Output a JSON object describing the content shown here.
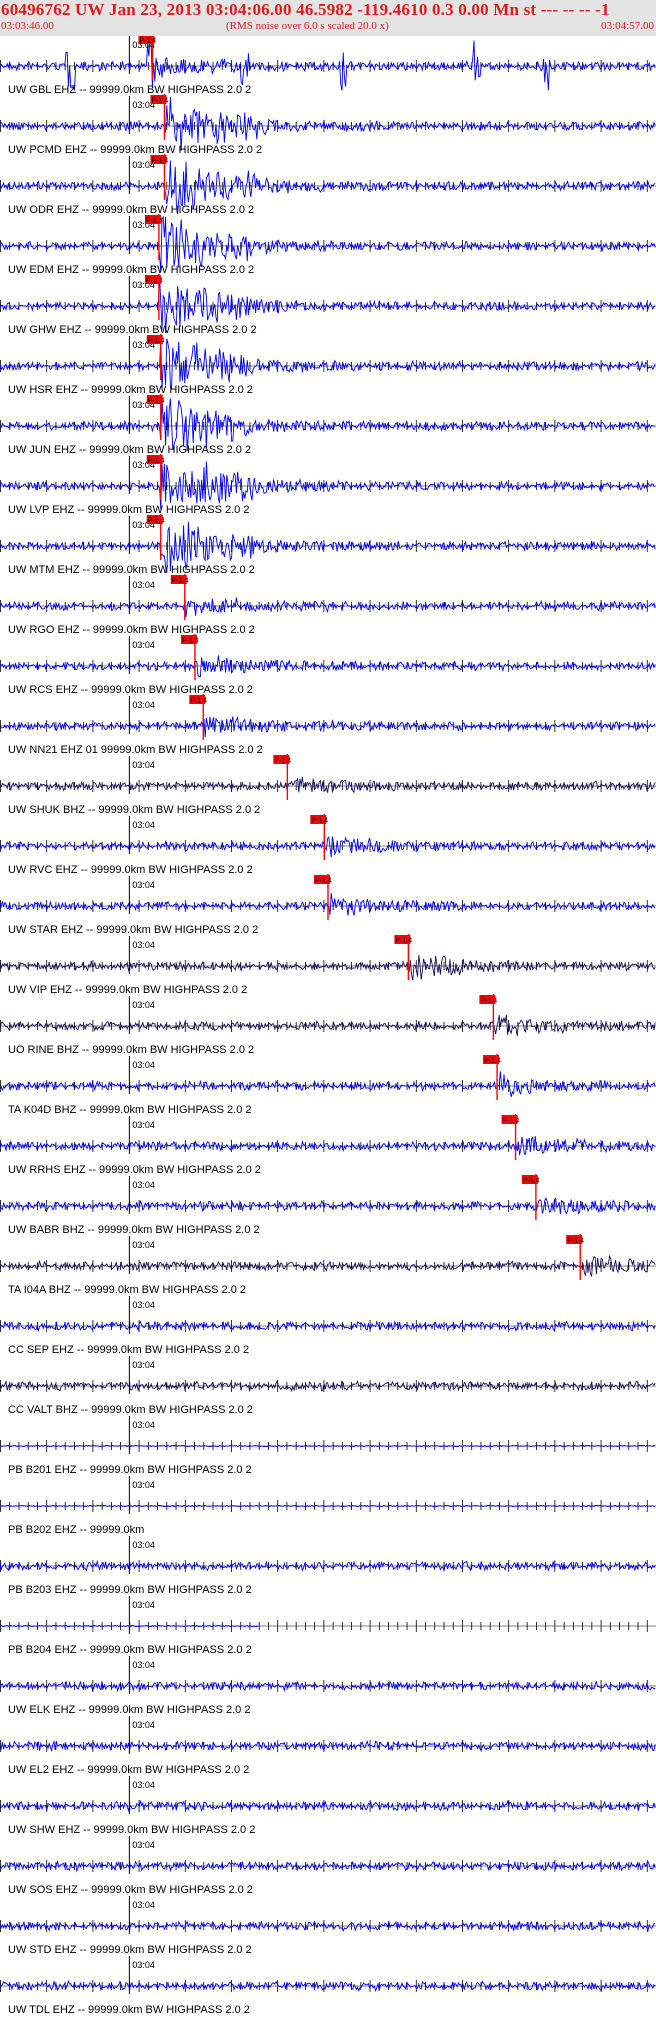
{
  "header": {
    "title": "60496762 UW Jan 23, 2013 03:04:06.00   46.5982 -119.4610  0.3 0.00 Mn st --- -- --  -1",
    "start_time": "03:03:46.00",
    "note": "(RMS noise over 6.0 s scaled 20.0 x)",
    "end_time": "03:04:57.00"
  },
  "chart_data": {
    "type": "line",
    "title": "60496762 UW Jan 23, 2013 03:04:06.00   46.5982 -119.4610  0.3 0.00 Mn st --- -- --  -1",
    "x_range": [
      "03:03:46.00",
      "03:04:57.00"
    ],
    "minute_tick_label": "03:04",
    "pick_label": "P-1.4",
    "grid": false,
    "colors": {
      "trace_blue": "#0000ff",
      "trace_dark": "#1a0a5e",
      "pick_red": "#ff0000",
      "tick": "#000000"
    },
    "series": [
      {
        "name": "UW GBL EHZ -- 99999.0km BW  HIGHPASS  2.0  2",
        "pick_s": 16.5,
        "label_pos": "bottom"
      },
      {
        "name": "UW PCMD EHZ -- 99999.0km BW  HIGHPASS  2.0  2",
        "pick_s": 17.8,
        "label_pos": "bottom"
      },
      {
        "name": "UW ODR EHZ -- 99999.0km BW  HIGHPASS  2.0  2",
        "pick_s": 17.8,
        "label_pos": "bottom"
      },
      {
        "name": "UW EDM EHZ -- 99999.0km BW  HIGHPASS  2.0  2",
        "pick_s": 17.2,
        "label_pos": "bottom"
      },
      {
        "name": "UW GHW EHZ -- 99999.0km BW  HIGHPASS  2.0  2",
        "pick_s": 17.2,
        "label_pos": "bottom"
      },
      {
        "name": "UW HSR EHZ -- 99999.0km BW  HIGHPASS  2.0  2",
        "pick_s": 17.4,
        "label_pos": "bottom"
      },
      {
        "name": "UW JUN EHZ -- 99999.0km BW  HIGHPASS  2.0  2",
        "pick_s": 17.4,
        "label_pos": "bottom"
      },
      {
        "name": "UW LVP EHZ -- 99999.0km BW  HIGHPASS  2.0  2",
        "pick_s": 17.4,
        "label_pos": "bottom"
      },
      {
        "name": "UW MTM EHZ -- 99999.0km BW  HIGHPASS  2.0  2",
        "pick_s": 17.4,
        "label_pos": "bottom"
      },
      {
        "name": "UW RGO EHZ -- 99999.0km BW  HIGHPASS  2.0  2",
        "pick_s": 20.0,
        "label_pos": "bottom"
      },
      {
        "name": "UW RCS EHZ -- 99999.0km BW  HIGHPASS  2.0  2",
        "pick_s": 21.1,
        "label_pos": "bottom"
      },
      {
        "name": "UW NN21 EHZ 01 99999.0km BW  HIGHPASS  2.0  2",
        "pick_s": 22.0,
        "label_pos": "bottom"
      },
      {
        "name": "UW SHUK BHZ -- 99999.0km BW  HIGHPASS  2.0  2",
        "pick_s": 31.1,
        "label_pos": "bottom"
      },
      {
        "name": "UW RVC EHZ -- 99999.0km BW  HIGHPASS  2.0  2",
        "pick_s": 35.1,
        "label_pos": "bottom"
      },
      {
        "name": "UW STAR EHZ -- 99999.0km BW  HIGHPASS  2.0  2",
        "pick_s": 35.5,
        "label_pos": "bottom"
      },
      {
        "name": "UW VIP EHZ -- 99999.0km BW  HIGHPASS  2.0  2",
        "pick_s": 44.2,
        "label_pos": "bottom"
      },
      {
        "name": "UO RINE BHZ -- 99999.0km BW  HIGHPASS  2.0  2",
        "pick_s": 53.4,
        "label_pos": "bottom"
      },
      {
        "name": "TA K04D BHZ -- 99999.0km BW  HIGHPASS  2.0  2",
        "pick_s": 53.8,
        "label_pos": "bottom"
      },
      {
        "name": "UW RRHS EHZ -- 99999.0km BW  HIGHPASS  2.0  2",
        "pick_s": 55.8,
        "label_pos": "bottom"
      },
      {
        "name": "UW BABR BHZ -- 99999.0km BW  HIGHPASS  2.0  2",
        "pick_s": 58.0,
        "label_pos": "bottom"
      },
      {
        "name": "TA I04A BHZ -- 99999.0km BW  HIGHPASS  2.0  2",
        "pick_s": 62.8,
        "label_pos": "bottom"
      },
      {
        "name": "CC SEP EHZ -- 99999.0km BW  HIGHPASS  2.0  2",
        "pick_s": null,
        "label_pos": "bottom"
      },
      {
        "name": "CC VALT BHZ -- 99999.0km BW  HIGHPASS  2.0  2",
        "pick_s": null,
        "label_pos": "bottom"
      },
      {
        "name": "PB B201 EHZ -- 99999.0km BW  HIGHPASS  2.0  2",
        "pick_s": null,
        "label_pos": "bottom"
      },
      {
        "name": "PB B202 EHZ -- 99999.0km",
        "pick_s": null,
        "label_pos": "bottom"
      },
      {
        "name": "PB B203 EHZ -- 99999.0km BW  HIGHPASS  2.0  2",
        "pick_s": null,
        "label_pos": "bottom"
      },
      {
        "name": "PB B204 EHZ -- 99999.0km BW  HIGHPASS  2.0  2",
        "pick_s": null,
        "label_pos": "bottom"
      },
      {
        "name": "UW ELK EHZ -- 99999.0km BW  HIGHPASS  2.0  2",
        "pick_s": null,
        "label_pos": "bottom"
      },
      {
        "name": "UW EL2 EHZ -- 99999.0km BW  HIGHPASS  2.0  2",
        "pick_s": null,
        "label_pos": "bottom"
      },
      {
        "name": "UW SHW EHZ -- 99999.0km BW  HIGHPASS  2.0  2",
        "pick_s": null,
        "label_pos": "bottom"
      },
      {
        "name": "UW SOS EHZ -- 99999.0km BW  HIGHPASS  2.0  2",
        "pick_s": null,
        "label_pos": "bottom"
      },
      {
        "name": "UW STD EHZ -- 99999.0km BW  HIGHPASS  2.0  2",
        "pick_s": null,
        "label_pos": "bottom"
      },
      {
        "name": "UW TDL EHZ -- 99999.0km BW  HIGHPASS  2.0  2",
        "pick_s": null,
        "label_pos": "bottom"
      }
    ]
  }
}
